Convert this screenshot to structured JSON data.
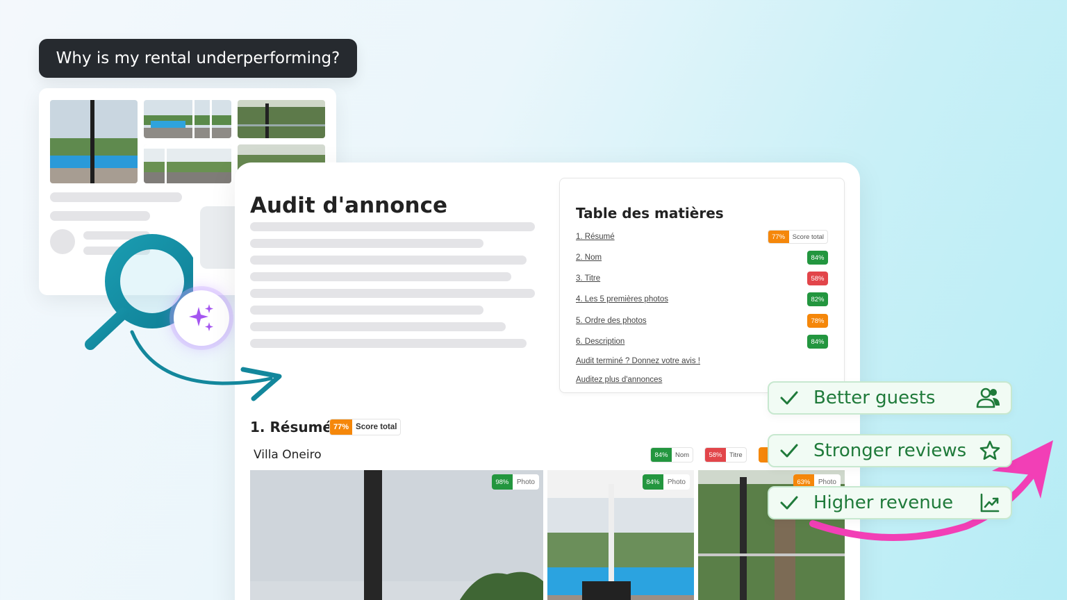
{
  "question": "Why is my rental underperforming?",
  "report": {
    "title": "Audit d'annonce",
    "toc": {
      "title": "Table des matières",
      "items": [
        {
          "label": "1. Résumé",
          "score": "77%",
          "extra": "Score total",
          "color": "#f5870a"
        },
        {
          "label": "2. Nom",
          "score": "84%",
          "color": "#23963f"
        },
        {
          "label": "3. Titre",
          "score": "58%",
          "color": "#e2454a"
        },
        {
          "label": "4. Les 5 premières photos",
          "score": "82%",
          "color": "#23963f"
        },
        {
          "label": "5. Ordre des photos",
          "score": "78%",
          "color": "#f5870a"
        },
        {
          "label": "6. Description",
          "score": "84%",
          "color": "#23963f"
        }
      ],
      "feedback_link": "Audit terminé ? Donnez votre avis !",
      "more_link": "Auditez plus d'annonces"
    },
    "summary": {
      "title": "1. Résumé",
      "score": "77%",
      "score_label": "Score total",
      "listing_name": "Villa Oneiro",
      "badges": [
        {
          "score": "84%",
          "label": "Nom"
        },
        {
          "score": "58%",
          "label": "Titre"
        }
      ],
      "photos": [
        {
          "score": "98%",
          "label": "Photo"
        },
        {
          "score": "84%",
          "label": "Photo"
        },
        {
          "score": "63%",
          "label": "Photo"
        }
      ]
    }
  },
  "benefits": [
    {
      "text": "Better guests",
      "icon": "users-icon"
    },
    {
      "text": "Stronger reviews",
      "icon": "star-icon"
    },
    {
      "text": "Higher revenue",
      "icon": "chart-up-icon"
    }
  ],
  "colors": {
    "green": "#23963f",
    "red": "#e2454a",
    "orange": "#f5870a",
    "teal": "#1a9bb0",
    "pink": "#f23fb6",
    "benefit_green": "#1f7a3a"
  }
}
